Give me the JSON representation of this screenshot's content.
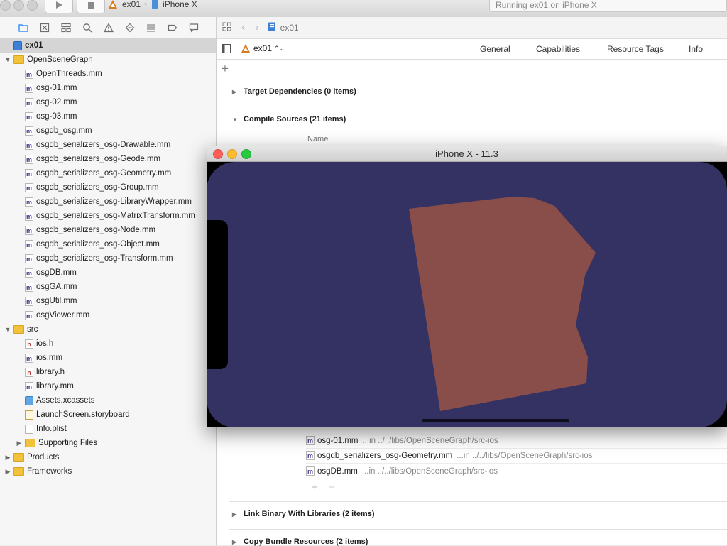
{
  "toolbar": {
    "scheme_target": "ex01",
    "scheme_device": "iPhone X",
    "status": "Running ex01 on iPhone X"
  },
  "navigator": {
    "tabs": [
      "project-navigator",
      "source-control-navigator",
      "symbol-navigator",
      "find-navigator",
      "issue-navigator",
      "test-navigator",
      "debug-navigator",
      "breakpoint-navigator",
      "report-navigator"
    ],
    "items": [
      {
        "label": "ex01",
        "icon": "project-icon",
        "depth": 0,
        "disclosure": "",
        "selected": true
      },
      {
        "label": "OpenSceneGraph",
        "icon": "folder-icon",
        "depth": 0,
        "disclosure": "open"
      },
      {
        "label": "OpenThreads.mm",
        "icon": "m",
        "depth": 1
      },
      {
        "label": "osg-01.mm",
        "icon": "m",
        "depth": 1
      },
      {
        "label": "osg-02.mm",
        "icon": "m",
        "depth": 1
      },
      {
        "label": "osg-03.mm",
        "icon": "m",
        "depth": 1
      },
      {
        "label": "osgdb_osg.mm",
        "icon": "m",
        "depth": 1
      },
      {
        "label": "osgdb_serializers_osg-Drawable.mm",
        "icon": "m",
        "depth": 1
      },
      {
        "label": "osgdb_serializers_osg-Geode.mm",
        "icon": "m",
        "depth": 1
      },
      {
        "label": "osgdb_serializers_osg-Geometry.mm",
        "icon": "m",
        "depth": 1
      },
      {
        "label": "osgdb_serializers_osg-Group.mm",
        "icon": "m",
        "depth": 1
      },
      {
        "label": "osgdb_serializers_osg-LibraryWrapper.mm",
        "icon": "m",
        "depth": 1
      },
      {
        "label": "osgdb_serializers_osg-MatrixTransform.mm",
        "icon": "m",
        "depth": 1
      },
      {
        "label": "osgdb_serializers_osg-Node.mm",
        "icon": "m",
        "depth": 1
      },
      {
        "label": "osgdb_serializers_osg-Object.mm",
        "icon": "m",
        "depth": 1
      },
      {
        "label": "osgdb_serializers_osg-Transform.mm",
        "icon": "m",
        "depth": 1
      },
      {
        "label": "osgDB.mm",
        "icon": "m",
        "depth": 1
      },
      {
        "label": "osgGA.mm",
        "icon": "m",
        "depth": 1
      },
      {
        "label": "osgUtil.mm",
        "icon": "m",
        "depth": 1
      },
      {
        "label": "osgViewer.mm",
        "icon": "m",
        "depth": 1
      },
      {
        "label": "src",
        "icon": "folder-icon",
        "depth": 0,
        "disclosure": "open"
      },
      {
        "label": "ios.h",
        "icon": "h",
        "depth": 1
      },
      {
        "label": "ios.mm",
        "icon": "m",
        "depth": 1
      },
      {
        "label": "library.h",
        "icon": "h",
        "depth": 1
      },
      {
        "label": "library.mm",
        "icon": "m",
        "depth": 1
      },
      {
        "label": "Assets.xcassets",
        "icon": "assets",
        "depth": 1
      },
      {
        "label": "LaunchScreen.storyboard",
        "icon": "board",
        "depth": 1
      },
      {
        "label": "Info.plist",
        "icon": "plist",
        "depth": 1
      },
      {
        "label": "Supporting Files",
        "icon": "folder-icon",
        "depth": 1,
        "disclosure": "closed"
      },
      {
        "label": "Products",
        "icon": "folder-icon",
        "depth": 0,
        "disclosure": "closed"
      },
      {
        "label": "Frameworks",
        "icon": "folder-icon",
        "depth": 0,
        "disclosure": "closed"
      }
    ]
  },
  "editor": {
    "breadcrumb": "ex01",
    "target_name": "ex01",
    "tabs": [
      "General",
      "Capabilities",
      "Resource Tags",
      "Info"
    ],
    "sections": {
      "target_dependencies": "Target Dependencies (0 items)",
      "compile_sources": "Compile Sources (21 items)",
      "link_binary": "Link Binary With Libraries (2 items)",
      "copy_bundle": "Copy Bundle Resources (2 items)"
    },
    "column_name": "Name",
    "sources": [
      {
        "file": "osg-01.mm",
        "path": "...in ../../libs/OpenSceneGraph/src-ios"
      },
      {
        "file": "osgdb_serializers_osg-Geometry.mm",
        "path": "...in ../../libs/OpenSceneGraph/src-ios"
      },
      {
        "file": "osgDB.mm",
        "path": "...in ../../libs/OpenSceneGraph/src-ios"
      }
    ]
  },
  "simulator": {
    "title": "iPhone X - 11.3",
    "background_color": "#343163",
    "shape_color": "#8a4e4a"
  }
}
